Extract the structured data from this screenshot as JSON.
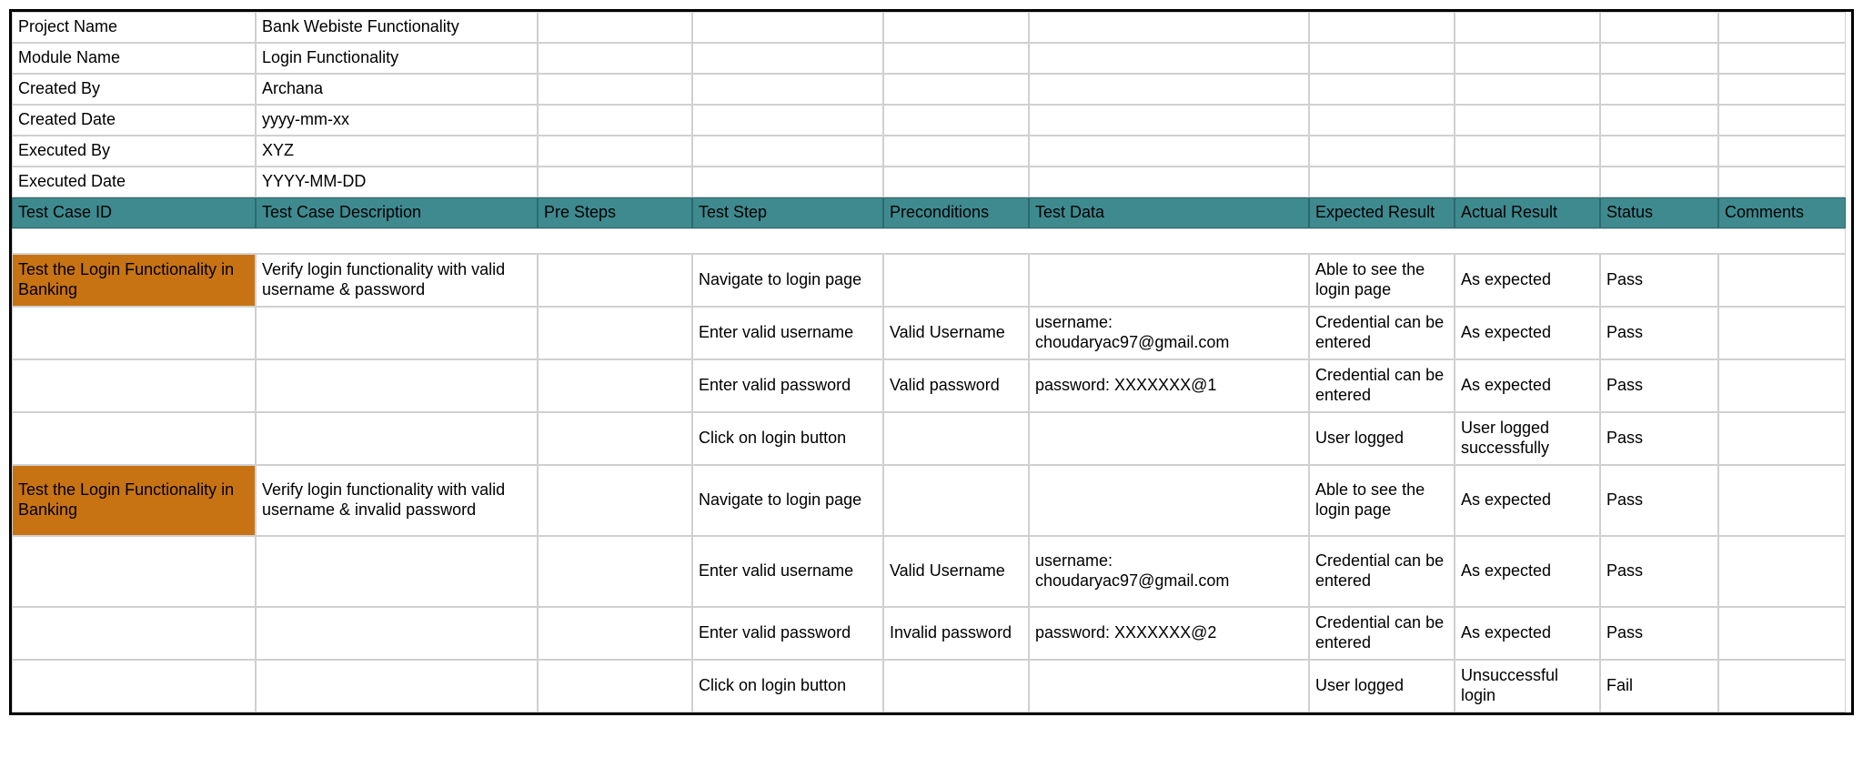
{
  "meta": [
    {
      "label": "Project Name",
      "value": "Bank Webiste Functionality"
    },
    {
      "label": "Module Name",
      "value": "Login Functionality"
    },
    {
      "label": "Created By",
      "value": "Archana"
    },
    {
      "label": "Created Date",
      "value": "yyyy-mm-xx"
    },
    {
      "label": "Executed By",
      "value": "XYZ"
    },
    {
      "label": "Executed Date",
      "value": "YYYY-MM-DD"
    }
  ],
  "headers": [
    "Test Case ID",
    "Test Case Description",
    "Pre Steps",
    "Test Step",
    "Preconditions",
    "Test Data",
    "Expected Result",
    "Actual Result",
    "Status",
    "Comments"
  ],
  "rows": [
    {
      "id": "Test the Login Functionality in Banking",
      "idClass": "orange tall",
      "desc": "Verify login functionality with valid username & password",
      "pre": "",
      "step": "Navigate to login page",
      "precond": "",
      "data": "",
      "expected": "Able to see the login page",
      "actual": "As expected",
      "status": "Pass",
      "comments": ""
    },
    {
      "id": "",
      "desc": "",
      "pre": "",
      "step": "Enter valid username",
      "precond": "Valid Username",
      "data": "username: choudaryac97@gmail.com",
      "expected": "Credential can be entered",
      "actual": "As expected",
      "status": "Pass",
      "comments": "",
      "rowClass": "tall"
    },
    {
      "id": "",
      "desc": "",
      "pre": "",
      "step": "Enter valid password",
      "precond": "Valid password",
      "data": "password: XXXXXXX@1",
      "expected": "Credential can be entered",
      "actual": "As expected",
      "status": "Pass",
      "comments": "",
      "rowClass": "tall"
    },
    {
      "id": "",
      "desc": "",
      "pre": "",
      "step": "Click on login button",
      "precond": "",
      "data": "",
      "expected": "User logged",
      "actual": "User logged successfully",
      "status": "Pass",
      "comments": "",
      "rowClass": "tall"
    },
    {
      "id": "Test the Login Functionality in Banking",
      "idClass": "orange taller",
      "desc": "Verify login functionality with valid username & invalid password",
      "pre": "",
      "step": "Navigate to login page",
      "precond": "",
      "data": "",
      "expected": "Able to see the login page",
      "actual": "As expected",
      "status": "Pass",
      "comments": ""
    },
    {
      "id": "",
      "desc": "",
      "pre": "",
      "step": "Enter valid username",
      "precond": "Valid Username",
      "data": "username: choudaryac97@gmail.com",
      "expected": "Credential can be entered",
      "actual": "As expected",
      "status": "Pass",
      "comments": "",
      "rowClass": "taller"
    },
    {
      "id": "",
      "desc": "",
      "pre": "",
      "step": "Enter valid password",
      "precond": "Invalid password",
      "data": "password: XXXXXXX@2",
      "expected": "Credential can be entered",
      "actual": "As expected",
      "status": "Pass",
      "comments": "",
      "rowClass": "tall"
    },
    {
      "id": "",
      "desc": "",
      "pre": "",
      "step": "Click on login button",
      "precond": "",
      "data": "",
      "expected": "User logged",
      "actual": "Unsuccessful login",
      "status": "Fail",
      "comments": "",
      "rowClass": "tall"
    }
  ]
}
